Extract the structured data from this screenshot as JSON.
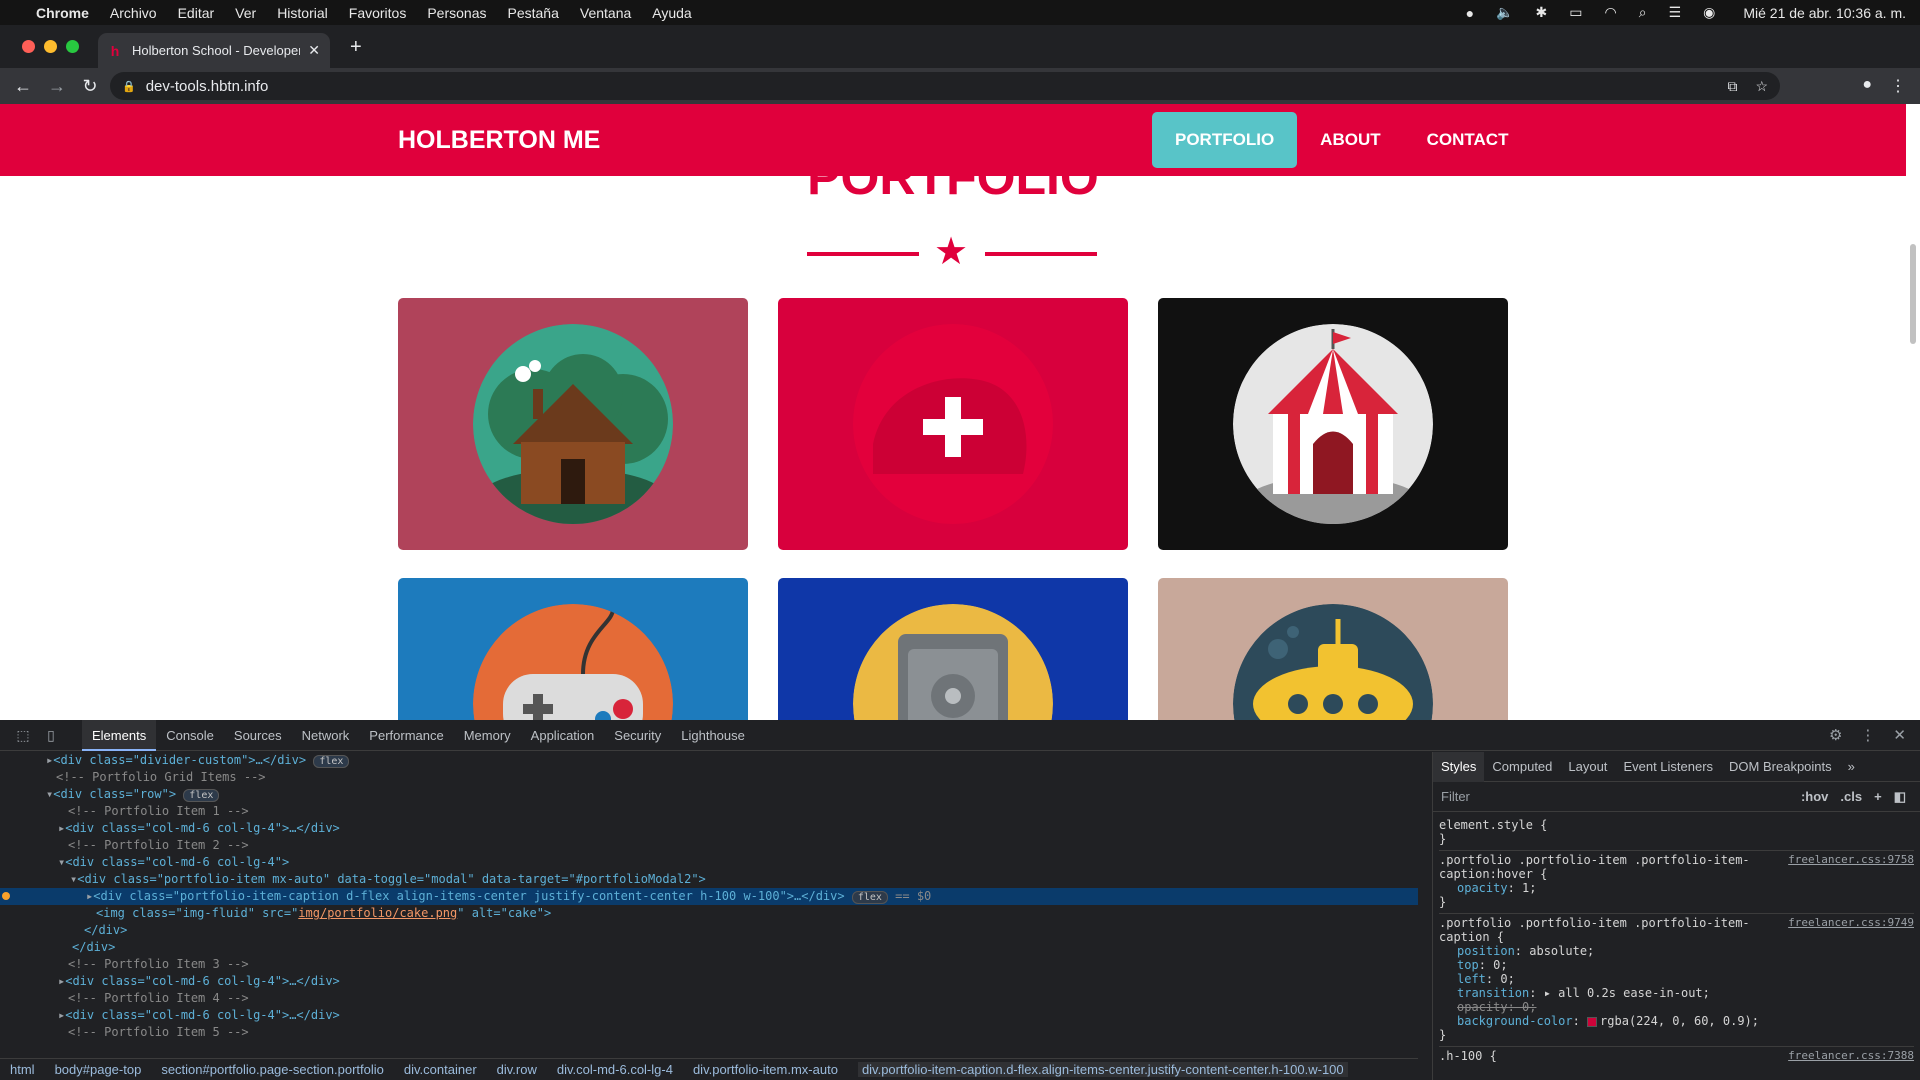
{
  "menubar": {
    "app": "Chrome",
    "items": [
      "Archivo",
      "Editar",
      "Ver",
      "Historial",
      "Favoritos",
      "Personas",
      "Pestaña",
      "Ventana",
      "Ayuda"
    ],
    "clock": "Mié 21 de abr. 10:36 a. m."
  },
  "tab": {
    "title": "Holberton School - Developer t",
    "favicon": "h"
  },
  "address": {
    "url": "dev-tools.hbtn.info"
  },
  "site": {
    "brand": "HOLBERTON ME",
    "nav": [
      "PORTFOLIO",
      "ABOUT",
      "CONTACT"
    ],
    "active_nav": "PORTFOLIO",
    "section_title": "PORTFOLIO",
    "colors": {
      "primary": "#e0003c",
      "active_nav": "#58c4c8"
    },
    "portfolio": [
      {
        "name": "cabin",
        "bg": "#b0435a"
      },
      {
        "name": "cake",
        "bg": "#d8003d"
      },
      {
        "name": "circus",
        "bg": "#111111"
      },
      {
        "name": "game",
        "bg": "#1d7bbd"
      },
      {
        "name": "safe",
        "bg": "#0f37a8"
      },
      {
        "name": "submarine",
        "bg": "#c8a89a"
      }
    ]
  },
  "devtools": {
    "tabs": [
      "Elements",
      "Console",
      "Sources",
      "Network",
      "Performance",
      "Memory",
      "Application",
      "Security",
      "Lighthouse"
    ],
    "active_tab": "Elements",
    "dom": {
      "l1": "<div class=\"divider-custom\">…</div>",
      "c1": "<!-- Portfolio Grid Items -->",
      "l2": "<div class=\"row\">",
      "c2": "<!-- Portfolio Item 1 -->",
      "l3": "<div class=\"col-md-6 col-lg-4\">…</div>",
      "c3": "<!-- Portfolio Item 2 -->",
      "l4": "<div class=\"col-md-6 col-lg-4\">",
      "l5": "<div class=\"portfolio-item mx-auto\" data-toggle=\"modal\" data-target=\"#portfolioModal2\">",
      "l6": "<div class=\"portfolio-item-caption d-flex align-items-center justify-content-center h-100 w-100\">…</div>",
      "l6_marker": "== $0",
      "l7_pre": "<img class=\"img-fluid\" src=\"",
      "l7_src": "img/portfolio/cake.png",
      "l7_post": "\" alt=\"cake\">",
      "l8": "</div>",
      "l9": "</div>",
      "c4": "<!-- Portfolio Item 3 -->",
      "l10": "<div class=\"col-md-6 col-lg-4\">…</div>",
      "c5": "<!-- Portfolio Item 4 -->",
      "l11": "<div class=\"col-md-6 col-lg-4\">…</div>",
      "c6": "<!-- Portfolio Item 5 -->",
      "badge": "flex"
    },
    "breadcrumbs": [
      "html",
      "body#page-top",
      "section#portfolio.page-section.portfolio",
      "div.container",
      "div.row",
      "div.col-md-6.col-lg-4",
      "div.portfolio-item.mx-auto",
      "div.portfolio-item-caption.d-flex.align-items-center.justify-content-center.h-100.w-100"
    ],
    "sidebar": {
      "tabs": [
        "Styles",
        "Computed",
        "Layout",
        "Event Listeners",
        "DOM Breakpoints"
      ],
      "active_tab": "Styles",
      "filter_placeholder": "Filter",
      "hov": ":hov",
      "cls": ".cls",
      "rule1": {
        "selector": "element.style {",
        "close": "}"
      },
      "rule2": {
        "selector": ".portfolio .portfolio-item .portfolio-item-caption:hover {",
        "src": "freelancer.css:9758",
        "p1n": "opacity",
        "p1v": "1;",
        "close": "}"
      },
      "rule3": {
        "selector": ".portfolio .portfolio-item .portfolio-item-caption {",
        "src": "freelancer.css:9749",
        "p1n": "position",
        "p1v": "absolute;",
        "p2n": "top",
        "p2v": "0;",
        "p3n": "left",
        "p3v": "0;",
        "p4n": "transition",
        "p4v": "▸ all 0.2s ease-in-out;",
        "p5": "opacity: 0;",
        "p6n": "background-color",
        "p6v": "rgba(224, 0, 60, 0.9);",
        "close": "}"
      },
      "rule4": {
        "selector": ".h-100 {",
        "src": "freelancer.css:7388"
      }
    }
  }
}
